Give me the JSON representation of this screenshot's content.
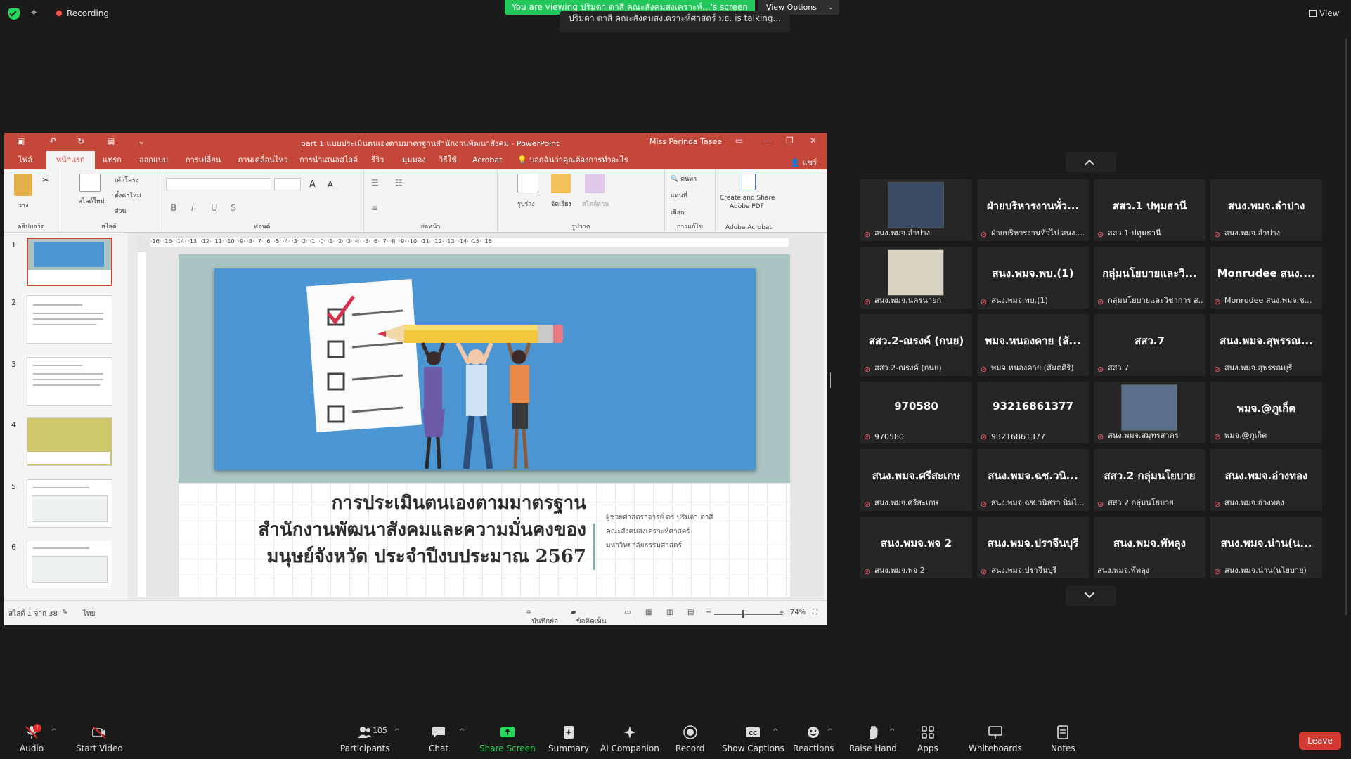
{
  "topbar": {
    "recording": "Recording",
    "viewing": "You are viewing ปริมดา ตาสี คณะสังคมสงเคราะห์...'s screen",
    "view_options": "View Options",
    "talking": "ปริมดา ตาสี คณะสังคมสงเคราะห์ศาสตร์ มธ. is talking...",
    "view": "View"
  },
  "ppt": {
    "window_title": "part 1 แบบประเมินตนเองตามมาตรฐานสำนักงานพัฒนาสังคม - PowerPoint",
    "user": "Miss Parinda Tasee",
    "tabs": [
      "ไฟล์",
      "หน้าแรก",
      "แทรก",
      "ออกแบบ",
      "การเปลี่ยน",
      "ภาพเคลื่อนไหว",
      "การนำเสนอสไลด์",
      "รีวิว",
      "มุมมอง",
      "วิธีใช้",
      "Acrobat",
      "บอกฉันว่าคุณต้องการทำอะไร"
    ],
    "share": "แชร์",
    "ribbon": {
      "paste": "วาง",
      "clipboard": "คลิปบอร์ด",
      "new_slide": "สไลด์ใหม่",
      "layout": "เค้าโครง",
      "reset": "ตั้งค่าใหม่",
      "section": "ส่วน",
      "slides": "สไลด์",
      "font": "ฟอนต์",
      "paragraph": "ย่อหน้า",
      "shapes": "รูปร่าง",
      "arrange": "จัดเรียง",
      "quick_styles": "สไตล์ด่วน",
      "drawing": "รูปวาด",
      "find": "ค้นหา",
      "replace": "แทนที่",
      "select": "เลือก",
      "editing": "การแก้ไข",
      "create_pdf_1": "Create and Share",
      "create_pdf_2": "Adobe PDF",
      "adobe": "Adobe Acrobat"
    },
    "thumb_numbers": [
      "1",
      "2",
      "3",
      "4",
      "5",
      "6"
    ],
    "ruler": "·16·  ·15·  ·14·  ·13·  ·12·  ·11·  ·10·  ·9·  ·8·  ·7·  ·6·  ·5·  ·4·  ·3·  ·2·  ·1·  ·0·  ·1·  ·2·  ·3·  ·4·  ·5·  ·6·  ·7·  ·8·  ·9·  ·10·  ·11·  ·12·  ·13·  ·14·  ·15·  ·16·",
    "slide": {
      "title_1": "การประเมินตนเองตามมาตรฐาน",
      "title_2": "สำนักงานพัฒนาสังคมและความมั่นคงของ",
      "title_3": "มนุษย์จังหวัด ประจำปีงบประมาณ 2567",
      "author_1": "ผู้ช่วยศาสตราจารย์ ดร.ปริมดา ตาสี",
      "author_2": "คณะสังคมสงเคราะห์ศาสตร์",
      "author_3": "มหาวิทยาลัยธรรมศาสตร์"
    },
    "status": {
      "slide_of": "สไลด์ 1 จาก 38",
      "lang": "ไทย",
      "notes": "บันทึกย่อ",
      "comments": "ข้อคิดเห็น",
      "zoom": "74%"
    }
  },
  "tiles": [
    {
      "name": "",
      "label": "สนง.พมจ.ลำปาง",
      "photo": "p1"
    },
    {
      "name": "ฝ่ายบริหารงานทั่ว...",
      "label": "ฝ่ายบริหารงานทั่วไป สนง...."
    },
    {
      "name": "สสว.1 ปทุมธานี",
      "label": "สสว.1 ปทุมธานี"
    },
    {
      "name": "สนง.พมจ.ลำปาง",
      "label": "สนง.พมจ.ลำปาง"
    },
    {
      "name": "",
      "label": "สนง.พมจ.นครนายก",
      "photo": "p2"
    },
    {
      "name": "สนง.พมจ.พบ.(1)",
      "label": "สนง.พมจ.พบ.(1)"
    },
    {
      "name": "กลุ่มนโยบายและวิ...",
      "label": "กลุ่มนโยบายและวิชาการ ส..."
    },
    {
      "name": "Monrudee สนง....",
      "label": "Monrudee สนง.พมจ.ช..."
    },
    {
      "name": "สสว.2-ณรงค์ (กนย)",
      "label": "สสว.2-ณรงค์ (กนย)"
    },
    {
      "name": "พมจ.หนองคาย (สั...",
      "label": "พมจ.หนองคาย (สันตศิริ)"
    },
    {
      "name": "สสว.7",
      "label": "สสว.7"
    },
    {
      "name": "สนง.พมจ.สุพรรณ...",
      "label": "สนง.พมจ.สุพรรณบุรี"
    },
    {
      "name": "970580",
      "label": "970580"
    },
    {
      "name": "93216861377",
      "label": "93216861377"
    },
    {
      "name": "",
      "label": "สนง.พมจ.สมุทรสาคร",
      "photo": "p3"
    },
    {
      "name": "พมจ.@ภูเก็ต",
      "label": "พมจ.@ภูเก็ต"
    },
    {
      "name": "สนง.พมจ.ศรีสะเกษ",
      "label": "สนง.พมจ.ศรีสะเกษ"
    },
    {
      "name": "สนง.พมจ.ฉช.วนิ...",
      "label": "สนง.พมจ.ฉช.วนิสรา นิ่มไ..."
    },
    {
      "name": "สสว.2 กลุ่มนโยบาย",
      "label": "สสว.2 กลุ่มนโยบาย"
    },
    {
      "name": "สนง.พมจ.อ่างทอง",
      "label": "สนง.พมจ.อ่างทอง"
    },
    {
      "name": "สนง.พมจ.พจ 2",
      "label": "สนง.พมจ.พจ 2"
    },
    {
      "name": "สนง.พมจ.ปราจีนบุรี",
      "label": "สนง.พมจ.ปราจีนบุรี"
    },
    {
      "name": "สนง.พมจ.พัทลุง",
      "label": "สนง.พมจ.พัทลุง",
      "nomic": true
    },
    {
      "name": "สนง.พมจ.น่าน(น...",
      "label": "สนง.พมจ.น่าน(นโยบาย)"
    }
  ],
  "toolbar": {
    "audio": "Audio",
    "start_video": "Start Video",
    "participants": "Participants",
    "participant_count": "105",
    "chat": "Chat",
    "share_screen": "Share Screen",
    "summary": "Summary",
    "ai_companion": "AI Companion",
    "record": "Record",
    "show_captions": "Show Captions",
    "reactions": "Reactions",
    "raise_hand": "Raise Hand",
    "apps": "Apps",
    "whiteboards": "Whiteboards",
    "notes": "Notes",
    "leave": "Leave",
    "audio_badge": "!"
  },
  "colors": {
    "ppt_accent": "#c4473a",
    "zoom_green": "#23d959",
    "leave_red": "#d53a32",
    "slide_blue": "#4a95d2"
  }
}
